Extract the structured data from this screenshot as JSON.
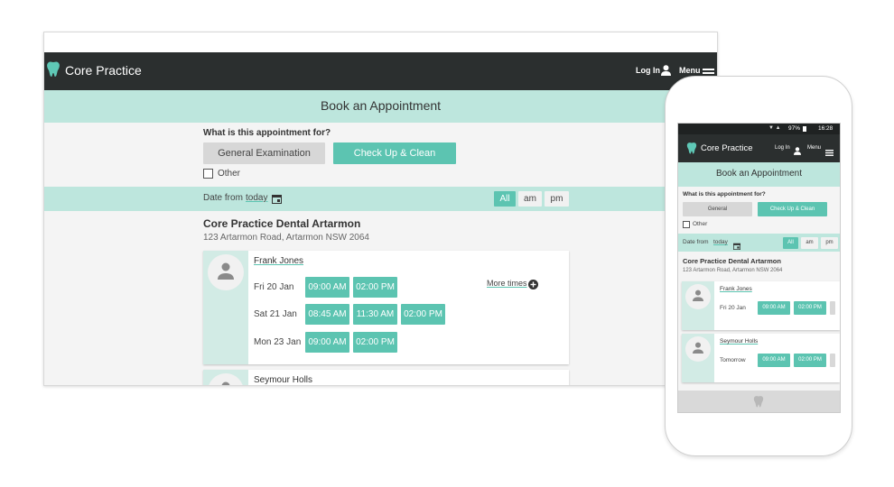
{
  "brand": {
    "name": "Core Practice",
    "accent": "#5cc4b1",
    "band": "#bde6dd",
    "dark": "#2b2f2f"
  },
  "nav": {
    "login_label": "Log In",
    "menu_label": "Menu"
  },
  "page_title": "Book an Appointment",
  "question": "What is this appointment for?",
  "options": {
    "general": "General Examination",
    "general_short": "General",
    "checkup": "Check Up & Clean"
  },
  "other_label": "Other",
  "date": {
    "prefix": "Date from",
    "value": "today"
  },
  "time_filter": [
    "All",
    "am",
    "pm"
  ],
  "practice": {
    "name": "Core Practice Dental Artarmon",
    "address": "123 Artarmon Road, Artarmon NSW 2064"
  },
  "more_times_label": "More times",
  "practitioners": [
    {
      "name": "Frank Jones",
      "days": [
        {
          "label": "Fri 20 Jan",
          "slots": [
            "09:00 AM",
            "02:00 PM"
          ]
        },
        {
          "label": "Sat 21 Jan",
          "slots": [
            "08:45 AM",
            "11:30 AM",
            "02:00 PM"
          ]
        },
        {
          "label": "Mon 23 Jan",
          "slots": [
            "09:00 AM",
            "02:00 PM"
          ]
        }
      ]
    },
    {
      "name": "Seymour Holls",
      "days": [
        {
          "label": "Tomorrow",
          "slots": [
            "09:00 AM",
            "02:00 PM"
          ]
        }
      ]
    }
  ],
  "status_bar": {
    "battery": "97%",
    "time": "16:28"
  }
}
